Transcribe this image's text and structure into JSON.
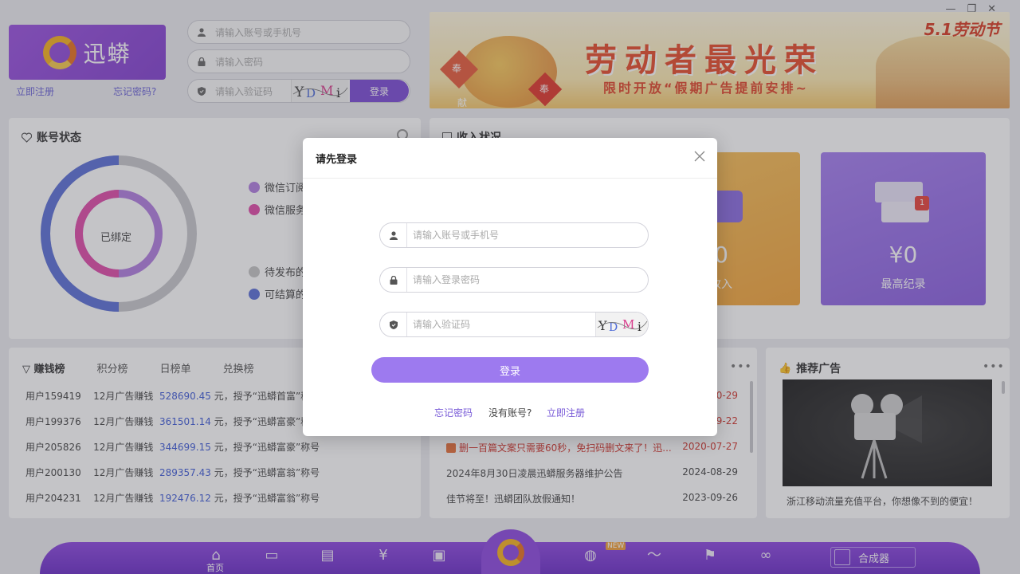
{
  "app": {
    "logo_text": "迅蟒",
    "register_link": "立即注册",
    "forgot_link": "忘记密码?",
    "account_placeholder": "请输入账号或手机号",
    "password_placeholder": "请输入密码",
    "captcha_placeholder": "请输入验证码",
    "login_label": "登录"
  },
  "banner": {
    "title": "劳动者最光荣",
    "subtitle": "限时开放“假期广告提前安排~",
    "corner": "5.1劳动节",
    "tag_left": "奉",
    "tag_mid": "奉",
    "tag_bottom": "献"
  },
  "account_state": {
    "title": "账号状态",
    "center_label": "已绑定",
    "legend": [
      "微信订阅",
      "微信服务",
      "待发布的",
      "可结算的"
    ],
    "legend_colors": [
      "#b27ee0",
      "#e04aa8",
      "#c4c4c4",
      "#5b6fd8"
    ]
  },
  "income": {
    "title": "收入状况",
    "card1_value": "0",
    "card1_label": "收入",
    "card2_value": "¥0",
    "card2_label": "最高纪录",
    "card2_badge": "1"
  },
  "rank": {
    "tabs": [
      "赚钱榜",
      "积分榜",
      "日榜单",
      "兑换榜"
    ],
    "rows": [
      {
        "user": "用户159419",
        "desc": "12月广告赚钱",
        "amount": "528690.45",
        "suffix": "元，授予“迅蟒首富”称号"
      },
      {
        "user": "用户199376",
        "desc": "12月广告赚钱",
        "amount": "361501.14",
        "suffix": "元，授予“迅蟒富豪”称号"
      },
      {
        "user": "用户205826",
        "desc": "12月广告赚钱",
        "amount": "344699.15",
        "suffix": "元，授予“迅蟒富豪”称号"
      },
      {
        "user": "用户200130",
        "desc": "12月广告赚钱",
        "amount": "289357.43",
        "suffix": "元，授予“迅蟒富翁”称号"
      },
      {
        "user": "用户204231",
        "desc": "12月广告赚钱",
        "amount": "192476.12",
        "suffix": "元，授予“迅蟒富翁”称号"
      }
    ]
  },
  "news": {
    "rows": [
      {
        "title": "",
        "date": "0-29",
        "hot": true
      },
      {
        "title": "",
        "date": "9-22",
        "hot": true
      },
      {
        "title": "删一百篇文案只需要60秒，免扫码删文来了！迅...",
        "date": "2020-07-27",
        "hot": true
      },
      {
        "title": "2024年8月30日凌晨迅蟒服务器维护公告",
        "date": "2024-08-29",
        "hot": false
      },
      {
        "title": "佳节将至！迅蟒团队放假通知！",
        "date": "2023-09-26",
        "hot": false
      }
    ]
  },
  "ad": {
    "title": "推荐广告",
    "caption": "浙江移动流量充值平台，你想像不到的便宜！"
  },
  "bottom": {
    "home_label": "首页",
    "new_badge": "NEW",
    "synth_label": "合成器"
  },
  "modal": {
    "title": "请先登录",
    "account_placeholder": "请输入账号或手机号",
    "password_placeholder": "请输入登录密码",
    "captcha_placeholder": "请输入验证码",
    "login_label": "登录",
    "forgot": "忘记密码",
    "no_account": "没有账号?",
    "register": "立即注册"
  }
}
